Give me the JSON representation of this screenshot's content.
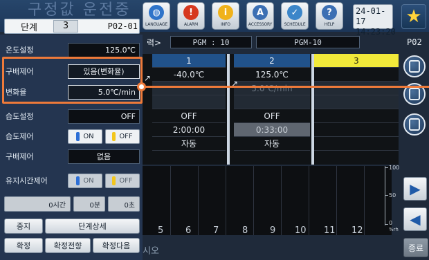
{
  "header": {
    "ghost_title": "구정값 운전중",
    "step_label": "단계",
    "step_number": "3",
    "program_code": "P02-01",
    "icons": [
      {
        "name": "globe-icon",
        "caption": "LANGUAGE",
        "color": "#2f74c9",
        "glyph": "◍"
      },
      {
        "name": "alarm-icon",
        "caption": "ALARM",
        "color": "#d6381f",
        "glyph": "!"
      },
      {
        "name": "info-icon",
        "caption": "INFO",
        "color": "#f0b21b",
        "glyph": "i"
      },
      {
        "name": "accessory-icon",
        "caption": "ACCESSORY",
        "color": "#3c6fb3",
        "glyph": "A"
      },
      {
        "name": "schedule-icon",
        "caption": "SCHEDULE",
        "color": "#3c86c9",
        "glyph": "✓"
      },
      {
        "name": "help-icon",
        "caption": "HELP",
        "color": "#3c6fb3",
        "glyph": "?"
      }
    ],
    "date": "24-01-17",
    "time": "14:23:20"
  },
  "left_panel": {
    "temp_setting_label": "온도설정",
    "temp_setting_value": "125.0℃",
    "slope_control_label": "구배제어",
    "slope_control_value": "있음(변화율)",
    "rate_label": "변화율",
    "rate_value": "5.0℃/min",
    "humidity_setting_label": "습도설정",
    "humidity_setting_value": "OFF",
    "humidity_control_label": "습도제어",
    "on_label": "ON",
    "off_label": "OFF",
    "slope_control2_label": "구배제어",
    "slope_control2_value": "없음",
    "hold_time_label": "유지시간제어",
    "hours": "0시간",
    "minutes": "0분",
    "seconds": "0초",
    "stop_button": "중지",
    "step_detail_button": "단계상세",
    "confirm_button": "확정",
    "confirm_prev_button": "확정전향",
    "confirm_next_button": "확정다음"
  },
  "program_bar": {
    "crumb": "력>",
    "pgm_label": "PGM : 10",
    "pgm_name": "PGM-10",
    "page_code": "P02"
  },
  "step_table": {
    "columns": [
      {
        "header": "1",
        "temp": "-40.0℃",
        "rate": "",
        "humidity": "OFF",
        "time": "2:00:00",
        "mode": "자동"
      },
      {
        "header": "2",
        "temp": "125.0℃",
        "rate": "5.0℃/min",
        "humidity": "OFF",
        "time": "0:33:00",
        "mode": "자동"
      },
      {
        "header": "3",
        "temp": "",
        "rate": "",
        "humidity": "",
        "time": "",
        "mode": ""
      }
    ]
  },
  "chart": {
    "y_labels": [
      "100",
      "50",
      "0"
    ],
    "y_unit": "%rh",
    "x_labels": [
      "5",
      "6",
      "7",
      "8",
      "9",
      "10",
      "11",
      "12"
    ]
  },
  "bottom_text": "시오",
  "end_button": "종료",
  "colors": {
    "highlight": "#ee7a3a",
    "selected_column": "#f1e93a",
    "header_blue": "#21528a"
  }
}
